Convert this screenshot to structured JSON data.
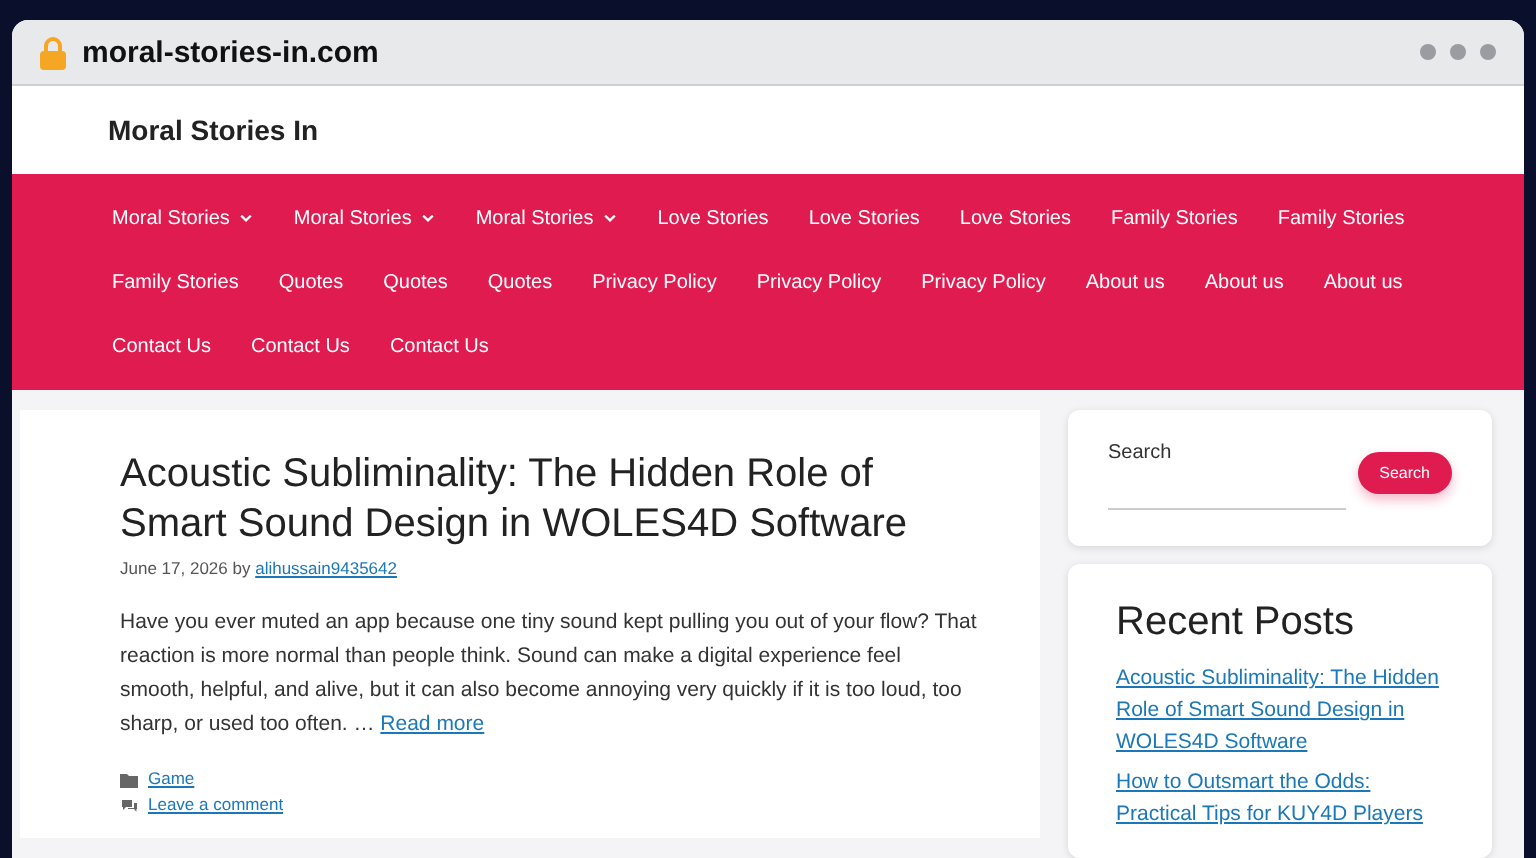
{
  "browser": {
    "url": "moral-stories-in.com"
  },
  "site": {
    "title": "Moral Stories In"
  },
  "nav": {
    "items": [
      {
        "label": "Moral Stories",
        "has_dropdown": true
      },
      {
        "label": "Moral Stories",
        "has_dropdown": true
      },
      {
        "label": "Moral Stories",
        "has_dropdown": true
      },
      {
        "label": "Love Stories",
        "has_dropdown": false
      },
      {
        "label": "Love Stories",
        "has_dropdown": false
      },
      {
        "label": "Love Stories",
        "has_dropdown": false
      },
      {
        "label": "Family Stories",
        "has_dropdown": false
      },
      {
        "label": "Family Stories",
        "has_dropdown": false
      },
      {
        "label": "Family Stories",
        "has_dropdown": false
      },
      {
        "label": "Quotes",
        "has_dropdown": false
      },
      {
        "label": "Quotes",
        "has_dropdown": false
      },
      {
        "label": "Quotes",
        "has_dropdown": false
      },
      {
        "label": "Privacy Policy",
        "has_dropdown": false
      },
      {
        "label": "Privacy Policy",
        "has_dropdown": false
      },
      {
        "label": "Privacy Policy",
        "has_dropdown": false
      },
      {
        "label": "About us",
        "has_dropdown": false
      },
      {
        "label": "About us",
        "has_dropdown": false
      },
      {
        "label": "About us",
        "has_dropdown": false
      },
      {
        "label": "Contact Us",
        "has_dropdown": false
      },
      {
        "label": "Contact Us",
        "has_dropdown": false
      },
      {
        "label": "Contact Us",
        "has_dropdown": false
      }
    ]
  },
  "article": {
    "title": "Acoustic Subliminality: The Hidden Role of Smart Sound Design in WOLES4D Software",
    "date": "June 17, 2026 by",
    "author": "alihussain9435642",
    "excerpt": "Have you ever muted an app because one tiny sound kept pulling you out of your flow? That reaction is more normal than people think. Sound can make a digital experience feel smooth, helpful, and alive, but it can also become annoying very quickly if it is too loud, too sharp, or used too often. …",
    "read_more": "Read more",
    "category": "Game",
    "comment_link": "Leave a comment"
  },
  "sidebar": {
    "search": {
      "label": "Search",
      "button": "Search"
    },
    "recent_posts": {
      "title": "Recent Posts",
      "links": [
        "Acoustic Subliminality: The Hidden Role of Smart Sound Design in WOLES4D Software",
        "How to Outsmart the Odds: Practical Tips for KUY4D Players"
      ]
    }
  }
}
